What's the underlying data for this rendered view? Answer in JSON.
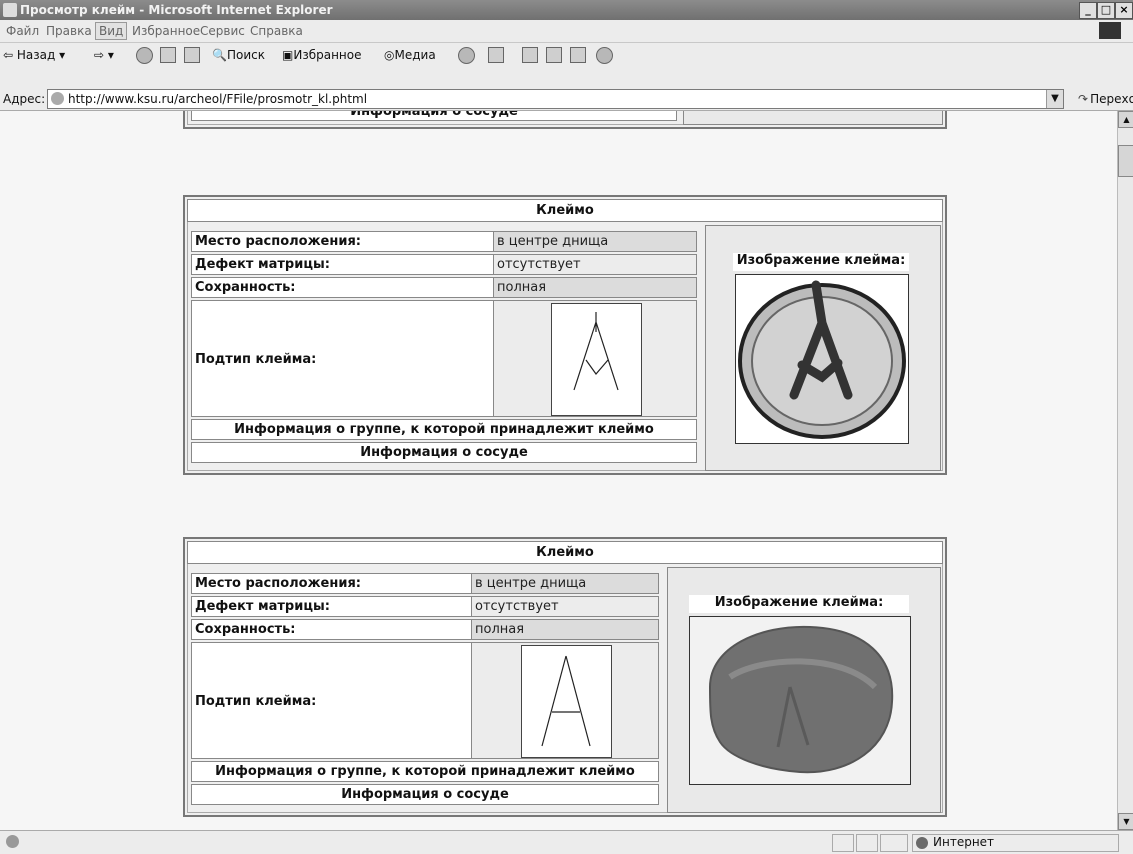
{
  "window": {
    "title": "Просмотр клейм - Microsoft Internet Explorer",
    "min": "_",
    "max": "□",
    "close": "×"
  },
  "menu": [
    "Файл",
    "Правка",
    "Вид",
    "Избранное",
    "Сервис",
    "Справка"
  ],
  "toolbar": {
    "back": "Назад",
    "search": "Поиск",
    "favorites": "Избранное",
    "media": "Медиа"
  },
  "address": {
    "label": "Адрес:",
    "url": "http://www.ksu.ru/archeol/FFile/prosmotr_kl.phtml",
    "go": "Переход"
  },
  "top_partial": {
    "info_vessel": "Информация о сосуде"
  },
  "records": [
    {
      "header": "Клеймо",
      "place_label": "Место расположения:",
      "place_value": "в центре днища",
      "defect_label": "Дефект матрицы:",
      "defect_value": "отсутствует",
      "preservation_label": "Сохранность:",
      "preservation_value": "полная",
      "subtype_label": "Подтип клейма:",
      "group_info": "Информация о группе, к которой принадлежит клеймо",
      "vessel_info": "Информация о сосуде",
      "image_title": "Изображение клейма:"
    },
    {
      "header": "Клеймо",
      "place_label": "Место расположения:",
      "place_value": "в центре днища",
      "defect_label": "Дефект матрицы:",
      "defect_value": "отсутствует",
      "preservation_label": "Сохранность:",
      "preservation_value": "полная",
      "subtype_label": "Подтип клейма:",
      "group_info": "Информация о группе, к которой принадлежит клеймо",
      "vessel_info": "Информация о сосуде",
      "image_title": "Изображение клейма:"
    }
  ],
  "status": {
    "zone": "Интернет"
  }
}
